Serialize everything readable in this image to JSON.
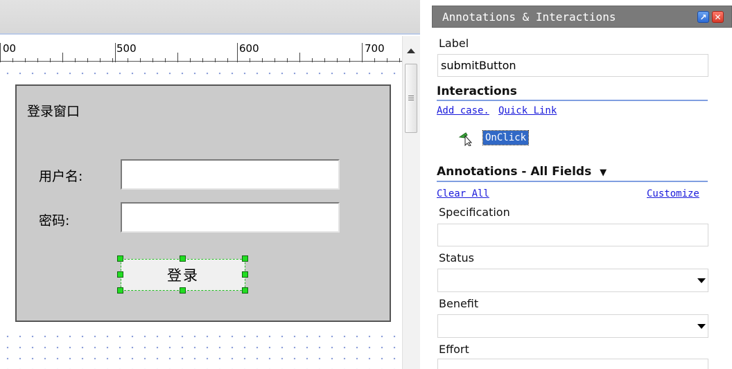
{
  "ruler": {
    "numbers": [
      "00",
      "500",
      "600",
      "700"
    ]
  },
  "login": {
    "title": "登录窗口",
    "username_label": "用户名:",
    "password_label": "密码:",
    "button_label": "登录"
  },
  "panel": {
    "title": "Annotations & Interactions",
    "dock_icon": "dock-icon",
    "close_icon": "close-icon",
    "label_caption": "Label",
    "label_value": "submitButton",
    "interactions_title": "Interactions",
    "add_case": "Add case.",
    "quick_link": "Quick Link",
    "event": "OnClick",
    "annotations_title": "Annotations - All Fields",
    "clear_all": "Clear All",
    "customize": "Customize",
    "fields": [
      "Specification",
      "Status",
      "Benefit",
      "Effort"
    ]
  },
  "colors": {
    "accent": "#3169c6",
    "handle": "#22dd22",
    "rule": "#7f9ee0",
    "link": "#1a1adb"
  }
}
